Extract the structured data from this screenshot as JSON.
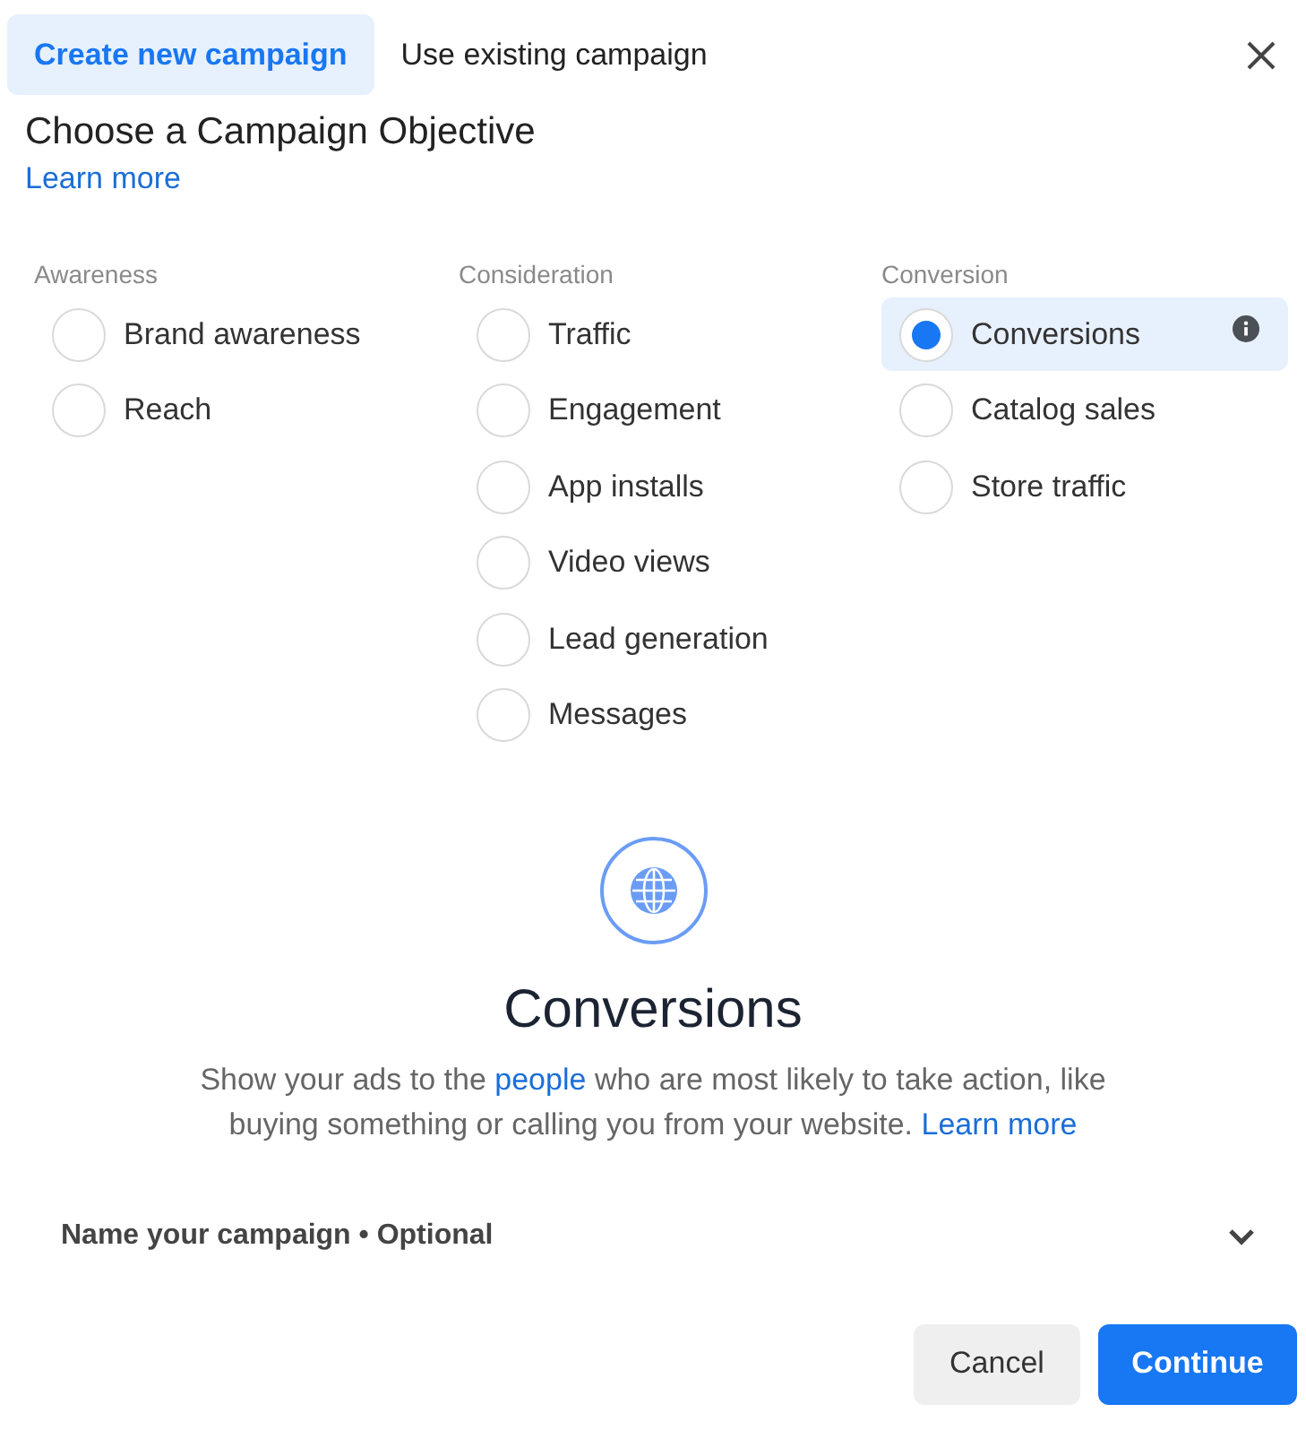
{
  "tabs": [
    {
      "label": "Create new campaign",
      "selected": true
    },
    {
      "label": "Use existing campaign",
      "selected": false
    }
  ],
  "title": "Choose a Campaign Objective",
  "learn_more": "Learn more",
  "groups": [
    {
      "heading": "Awareness",
      "options": [
        {
          "label": "Brand awareness",
          "selected": false
        },
        {
          "label": "Reach",
          "selected": false
        }
      ]
    },
    {
      "heading": "Consideration",
      "options": [
        {
          "label": "Traffic",
          "selected": false
        },
        {
          "label": "Engagement",
          "selected": false
        },
        {
          "label": "App installs",
          "selected": false
        },
        {
          "label": "Video views",
          "selected": false
        },
        {
          "label": "Lead generation",
          "selected": false
        },
        {
          "label": "Messages",
          "selected": false
        }
      ]
    },
    {
      "heading": "Conversion",
      "options": [
        {
          "label": "Conversions",
          "selected": true
        },
        {
          "label": "Catalog sales",
          "selected": false
        },
        {
          "label": "Store traffic",
          "selected": false
        }
      ]
    }
  ],
  "detail": {
    "heading": "Conversions",
    "before": "Show your ads to the",
    "link": "people",
    "after": "who are most likely to take action, like buying something or calling you from your website.",
    "learn_more": "Learn more"
  },
  "name_section": {
    "label": "Name your campaign • Optional",
    "expanded": false
  },
  "buttons": {
    "cancel": "Cancel",
    "continue": "Continue"
  }
}
